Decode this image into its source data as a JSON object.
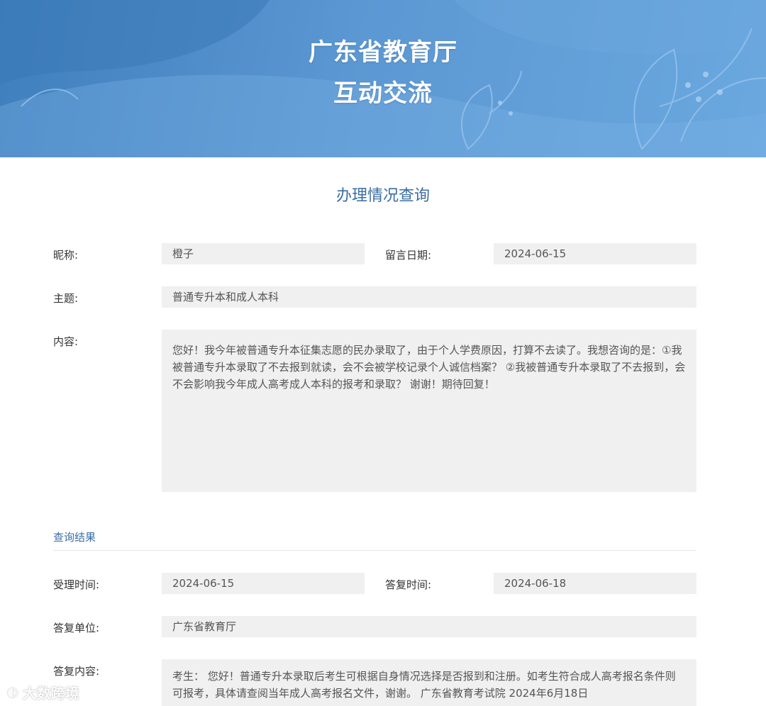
{
  "banner": {
    "title_line1": "广东省教育厅",
    "title_line2": "互动交流"
  },
  "page": {
    "section_title": "办理情况查询"
  },
  "message": {
    "nickname_label": "昵称:",
    "nickname": "橙子",
    "date_label": "留言日期:",
    "date": "2024-06-15",
    "subject_label": "主题:",
    "subject": "普通专升本和成人本科",
    "content_label": "内容:",
    "content": "您好！我今年被普通专升本征集志愿的民办录取了，由于个人学费原因，打算不去读了。我想咨询的是：①我被普通专升本录取了不去报到就读，会不会被学校记录个人诚信档案？ ②我被普通专升本录取了不去报到，会不会影响我今年成人高考成人本科的报考和录取？ 谢谢！期待回复！"
  },
  "result": {
    "heading": "查询结果",
    "accept_time_label": "受理时间:",
    "accept_time": "2024-06-15",
    "reply_time_label": "答复时间:",
    "reply_time": "2024-06-18",
    "reply_unit_label": "答复单位:",
    "reply_unit": "广东省教育厅",
    "reply_content_label": "答复内容:",
    "reply_content": "考生： 您好！普通专升本录取后考生可根据自身情况选择是否报到和注册。如考生符合成人高考报名条件则可报考，具体请查阅当年成人高考报名文件，谢谢。 广东省教育考试院 2024年6月18日"
  },
  "watermark": {
    "text": "大数跨境"
  },
  "colors": {
    "banner": "#5b97d2",
    "accent": "#3a6ea5",
    "field_bg": "#f0f0f0"
  }
}
